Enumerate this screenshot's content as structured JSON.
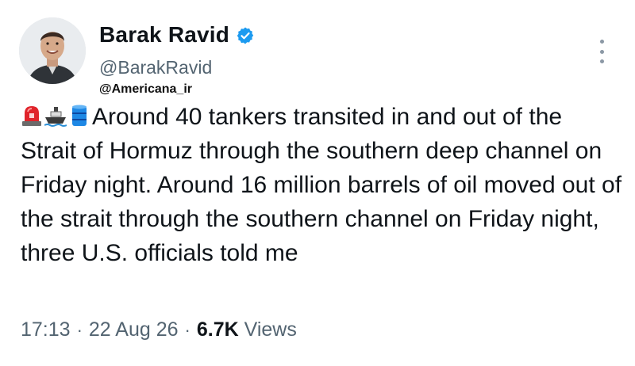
{
  "author": {
    "display_name": "Barak Ravid",
    "handle": "@BarakRavid",
    "verified_color": "#1d9bf0",
    "avatar": "profile-photo"
  },
  "watermark": "@Americana_ir",
  "tweet": {
    "emojis": [
      "police-light-emoji",
      "ship-emoji",
      "oil-drum-emoji"
    ],
    "text": "Around 40 tankers transited in and out of the Strait of Hormuz through the southern deep channel on Friday night. Around 16 million barrels of oil moved out of the strait through the southern channel on Friday night, three U.S. officials told me"
  },
  "meta": {
    "time": "17:13",
    "separator": "·",
    "date": "22 Aug 26",
    "views_count": "6.7K",
    "views_label": "Views"
  },
  "menu": {
    "icon": "more-vertical-icon"
  }
}
